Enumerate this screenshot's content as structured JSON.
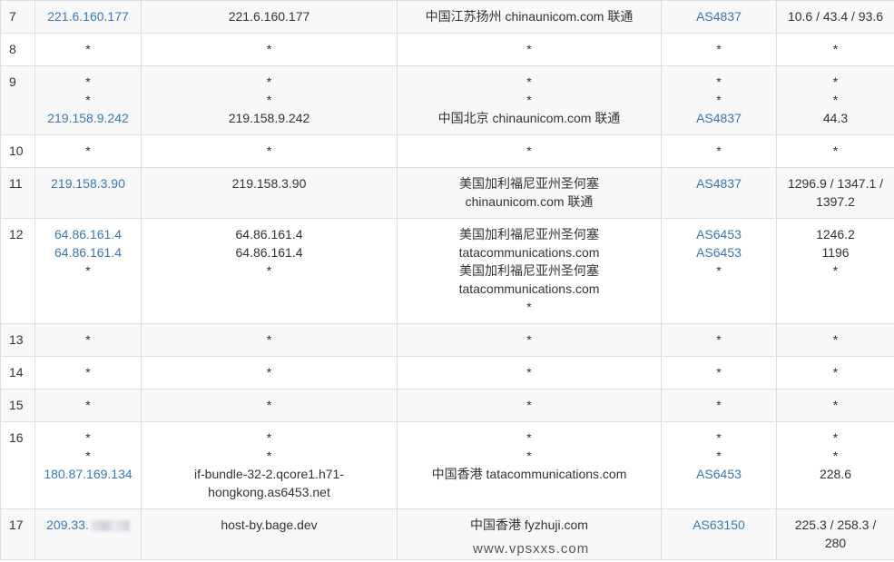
{
  "rows": [
    {
      "hop": "7",
      "ips": [
        "221.6.160.177"
      ],
      "hosts": [
        "221.6.160.177"
      ],
      "locs": [
        "中国江苏扬州 chinaunicom.com 联通"
      ],
      "as": [
        "AS4837"
      ],
      "rtt": [
        "10.6 / 43.4 / 93.6"
      ]
    },
    {
      "hop": "8",
      "ips": [
        "*"
      ],
      "hosts": [
        "*"
      ],
      "locs": [
        "*"
      ],
      "as": [
        "*"
      ],
      "rtt": [
        "*"
      ]
    },
    {
      "hop": "9",
      "ips": [
        "*",
        "*",
        "219.158.9.242"
      ],
      "hosts": [
        "*",
        "*",
        "219.158.9.242"
      ],
      "locs": [
        "*",
        "*",
        "中国北京 chinaunicom.com 联通"
      ],
      "as": [
        "*",
        "*",
        "AS4837"
      ],
      "rtt": [
        "*",
        "*",
        "44.3"
      ]
    },
    {
      "hop": "10",
      "ips": [
        "*"
      ],
      "hosts": [
        "*"
      ],
      "locs": [
        "*"
      ],
      "as": [
        "*"
      ],
      "rtt": [
        "*"
      ]
    },
    {
      "hop": "11",
      "ips": [
        "219.158.3.90"
      ],
      "hosts": [
        "219.158.3.90"
      ],
      "locs": [
        "美国加利福尼亚州圣何塞",
        "chinaunicom.com 联通"
      ],
      "as": [
        "AS4837"
      ],
      "rtt": [
        "1296.9 / 1347.1 /",
        "1397.2"
      ]
    },
    {
      "hop": "12",
      "ips": [
        "64.86.161.4",
        "64.86.161.4",
        "*"
      ],
      "hosts": [
        "64.86.161.4",
        "64.86.161.4",
        "*"
      ],
      "locs": [
        "美国加利福尼亚州圣何塞",
        "tatacommunications.com",
        "美国加利福尼亚州圣何塞",
        "tatacommunications.com",
        "*"
      ],
      "as": [
        "AS6453",
        "AS6453",
        "*"
      ],
      "rtt": [
        "1246.2",
        "1196",
        "*"
      ]
    },
    {
      "hop": "13",
      "ips": [
        "*"
      ],
      "hosts": [
        "*"
      ],
      "locs": [
        "*"
      ],
      "as": [
        "*"
      ],
      "rtt": [
        "*"
      ]
    },
    {
      "hop": "14",
      "ips": [
        "*"
      ],
      "hosts": [
        "*"
      ],
      "locs": [
        "*"
      ],
      "as": [
        "*"
      ],
      "rtt": [
        "*"
      ]
    },
    {
      "hop": "15",
      "ips": [
        "*"
      ],
      "hosts": [
        "*"
      ],
      "locs": [
        "*"
      ],
      "as": [
        "*"
      ],
      "rtt": [
        "*"
      ]
    },
    {
      "hop": "16",
      "ips": [
        "*",
        "*",
        "180.87.169.134"
      ],
      "hosts": [
        "*",
        "*",
        "if-bundle-32-2.qcore1.h71-",
        "hongkong.as6453.net"
      ],
      "locs": [
        "*",
        "*",
        "中国香港 tatacommunications.com"
      ],
      "as": [
        "*",
        "*",
        "AS6453"
      ],
      "rtt": [
        "*",
        "*",
        "228.6"
      ]
    },
    {
      "hop": "17",
      "ips": [
        "209.33."
      ],
      "hosts": [
        "host-by.bage.dev"
      ],
      "locs": [
        "中国香港 fyzhuji.com"
      ],
      "as": [
        "AS63150"
      ],
      "rtt": [
        "225.3 / 258.3 /",
        "280"
      ]
    }
  ],
  "watermark": "www.vpsxxs.com",
  "colors": {
    "link": "#3a78b5",
    "text": "#333333",
    "border": "#dfdfdf",
    "row_alt": "#f8f8f8"
  }
}
